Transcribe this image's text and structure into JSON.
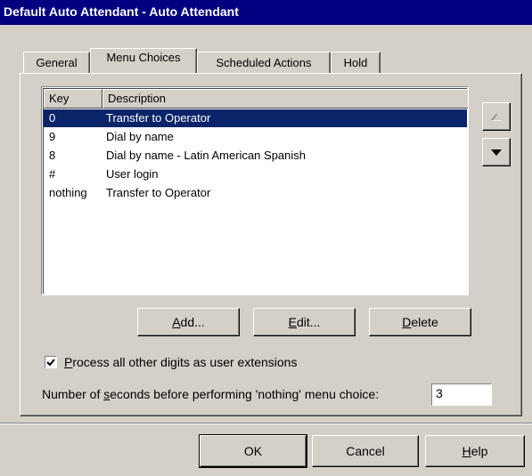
{
  "window": {
    "title": "Default Auto Attendant - Auto Attendant"
  },
  "tabs": [
    {
      "label": "General"
    },
    {
      "label": "Menu Choices",
      "active": true
    },
    {
      "label": "Scheduled Actions"
    },
    {
      "label": "Hold"
    }
  ],
  "menu_list": {
    "columns": {
      "key": "Key",
      "description": "Description"
    },
    "rows": [
      {
        "key": "0",
        "description": "Transfer to Operator",
        "selected": true
      },
      {
        "key": "9",
        "description": "Dial by name"
      },
      {
        "key": "8",
        "description": "Dial by name - Latin American Spanish"
      },
      {
        "key": "#",
        "description": "User login"
      },
      {
        "key": "nothing",
        "description": "Transfer to Operator"
      }
    ]
  },
  "list_buttons": {
    "add": {
      "underline": "A",
      "rest": "dd..."
    },
    "edit": {
      "underline": "E",
      "rest": "dit..."
    },
    "delete": {
      "underline": "D",
      "rest": "elete"
    }
  },
  "move_buttons": {
    "up_icon": "arrow-up-icon",
    "down_icon": "arrow-down-icon"
  },
  "process_digits": {
    "checked": true,
    "underline": "P",
    "rest": "rocess all other digits as user extensions"
  },
  "nothing_timeout": {
    "label_pre": "Number of ",
    "label_underline": "s",
    "label_post": "econds before performing 'nothing' menu choice:",
    "value": "3"
  },
  "dialog_buttons": {
    "ok": "OK",
    "cancel": "Cancel",
    "help": {
      "underline": "H",
      "rest": "elp"
    }
  },
  "colors": {
    "titlebar": "#000080",
    "selection": "#0a246a",
    "face": "#d4d0c8"
  }
}
